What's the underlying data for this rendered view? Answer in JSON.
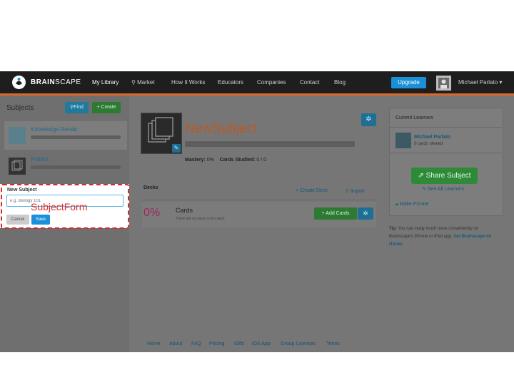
{
  "nav": {
    "brand_bold": "BRAIN",
    "brand_thin": "SCAPE",
    "items": [
      "My Library",
      "Market",
      "How It Works",
      "Educators",
      "Companies",
      "Contact",
      "Blog"
    ],
    "upgrade": "Upgrade",
    "user_name": "Michael Parlato",
    "user_caret": "▾",
    "accent": "#d9682a"
  },
  "sidebar": {
    "title": "Subjects",
    "find_label": "Find",
    "create_label": "Create",
    "subjects": [
      {
        "label": "Knowledge Rehab"
      },
      {
        "label": "Politics"
      }
    ]
  },
  "form": {
    "label": "New Subject",
    "placeholder": "e.g. Biology 101",
    "cancel": "Cancel",
    "save": "Save",
    "annotation": "SubjectForm",
    "highlight_color": "#d62a2a"
  },
  "subject": {
    "title": "NewSubject",
    "mastery_label": "Mastery:",
    "mastery_value": "0%",
    "studied_label": "Cards Studied:",
    "studied_value": "0 / 0",
    "gear_icon": "gear-icon"
  },
  "decks": {
    "title": "Decks",
    "create_deck": "Create Deck",
    "import": "Import",
    "percent": "0%",
    "cards_title": "Cards",
    "cards_sub": "There are no cards in this deck.",
    "add_cards": "Add Cards"
  },
  "right": {
    "current_learners": "Current Learners",
    "learner_name": "Michael Parlato",
    "learner_sub": "0 cards viewed",
    "share": "Share Subject",
    "see_all": "See All Learners",
    "make_private": "Make Private",
    "tip_bold": "Tip:",
    "tip_text": " You can study much more conveniently on Brainscape's iPhone or iPad app. ",
    "tip_link": "Get Brainscape on iTunes"
  },
  "footer": {
    "links": [
      "Home",
      "About",
      "FAQ",
      "Pricing",
      "Gifts",
      "iOS App",
      "Group Licenses",
      "Terms"
    ]
  }
}
